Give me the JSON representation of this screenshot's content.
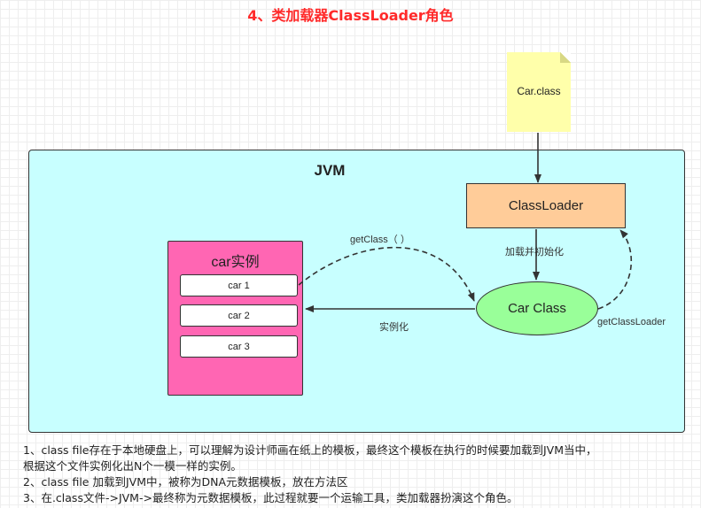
{
  "title": "4、类加载器ClassLoader角色",
  "file": {
    "label": "Car.class"
  },
  "jvm": {
    "label": "JVM"
  },
  "class_loader": {
    "label": "ClassLoader"
  },
  "instances": {
    "title": "car实例",
    "items": [
      "car 1",
      "car 2",
      "car 3"
    ]
  },
  "car_class": {
    "label": "Car Class"
  },
  "edges": {
    "load_init": "加载并初始化",
    "get_class": "getClass（  ）",
    "instantiate": "实例化",
    "get_class_loader": "getClassLoader"
  },
  "notes": [
    "1、class file存在于本地硬盘上，可以理解为设计师画在纸上的模板，最终这个模板在执行的时候要加载到JVM当中，",
    "根据这个文件实例化出N个一模一样的实例。",
    "2、class file 加载到JVM中，被称为DNA元数据模板，放在方法区",
    "3、在.class文件->JVM->最终称为元数据模板，此过程就要一个运输工具，类加载器扮演这个角色。"
  ]
}
